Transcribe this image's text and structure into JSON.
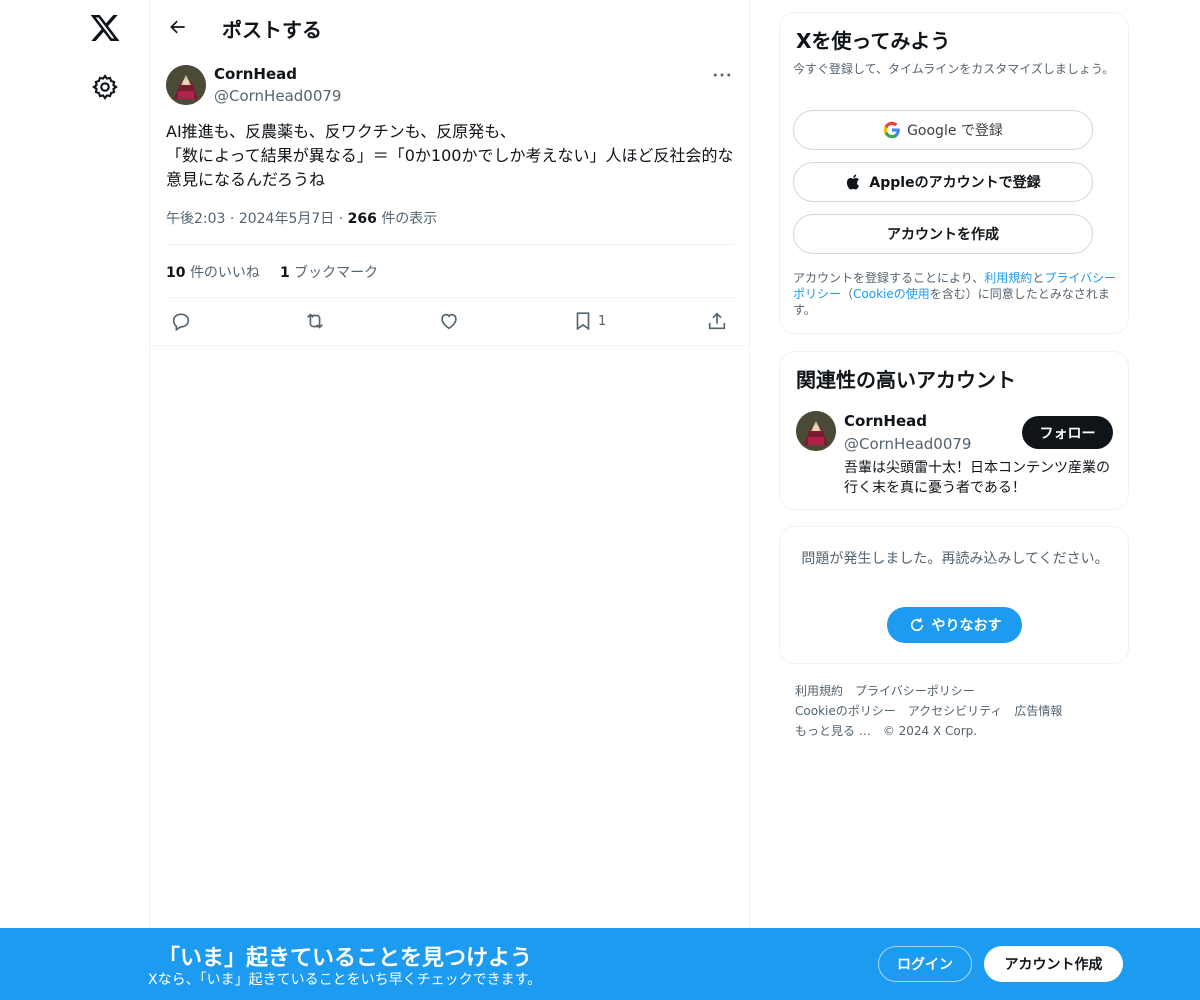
{
  "nav": {
    "logo_icon": "x-logo-icon",
    "settings_icon": "gear-icon"
  },
  "header": {
    "title": "ポストする",
    "back_icon": "arrow-left-icon"
  },
  "post": {
    "author_name": "CornHead",
    "author_handle": "@CornHead0079",
    "text": "AI推進も、反農薬も、反ワクチンも、反原発も、\n「数によって結果が異なる」＝「0か100かでしか考えない」人ほど反社会的な意見になるんだろうね",
    "time": "午後2:03",
    "date": "2024年5月7日",
    "view_count": "266",
    "view_label": "件の表示",
    "like_count": "10",
    "like_label": "件のいいね",
    "bookmark_count": "1",
    "bookmark_label": "ブックマーク",
    "bookmark_action_count": "1"
  },
  "signup_card": {
    "title": "Xを使ってみよう",
    "subtitle": "今すぐ登録して、タイムラインをカスタマイズしましょう。",
    "google_label": "Google で登録",
    "apple_label": "Appleのアカウントで登録",
    "create_label": "アカウントを作成",
    "legal_before": "アカウントを登録することにより、",
    "legal_terms": "利用規約",
    "legal_and": "と",
    "legal_privacy": "プライバシーポリシー",
    "legal_open": "（",
    "legal_cookie": "Cookieの使用",
    "legal_after": "を含む）に同意したとみなされます。"
  },
  "related": {
    "title": "関連性の高いアカウント",
    "name": "CornHead",
    "handle": "@CornHead0079",
    "bio": "吾輩は尖頭雷十太！日本コンテンツ産業の行く末を真に憂う者である！",
    "follow_label": "フォロー"
  },
  "error_card": {
    "message": "問題が発生しました。再読み込みしてください。",
    "retry_label": "やりなおす"
  },
  "footer": {
    "row1": [
      "利用規約",
      "プライバシーポリシー"
    ],
    "row2": [
      "Cookieのポリシー",
      "アクセシビリティ",
      "広告情報"
    ],
    "more": "もっと見る …",
    "copyright": "© 2024 X Corp."
  },
  "bottom_bar": {
    "title": "「いま」起きていることを見つけよう",
    "subtitle": "Xなら、「いま」起きていることをいち早くチェックできます。",
    "login_label": "ログイン",
    "signup_label": "アカウント作成"
  },
  "colors": {
    "accent": "#1d9bf0",
    "text": "#0f1419",
    "muted": "#536471",
    "border": "#eff3f4"
  }
}
